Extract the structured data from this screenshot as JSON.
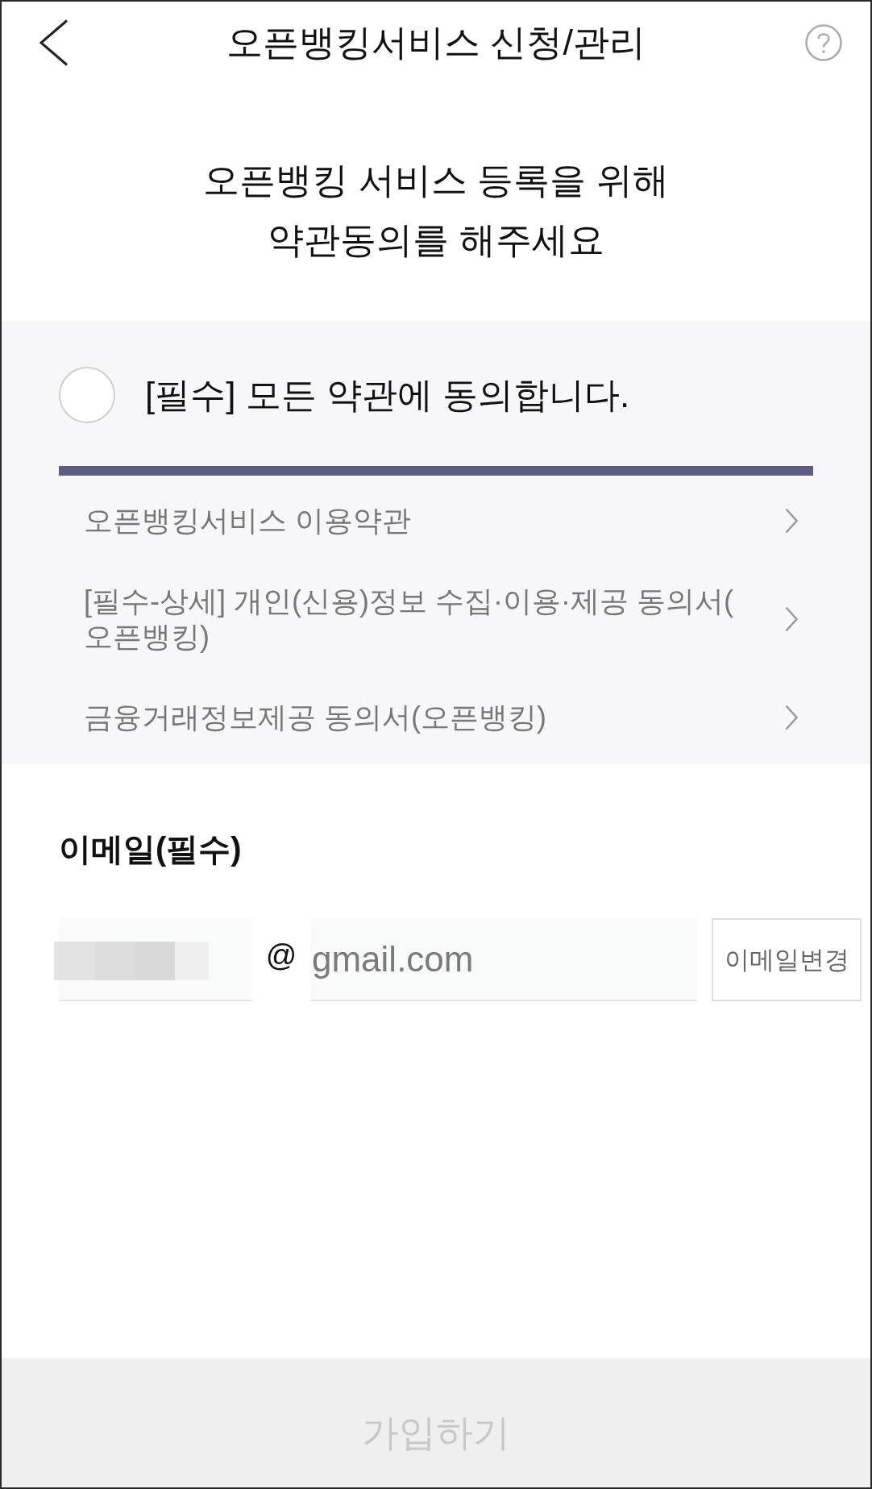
{
  "header": {
    "title": "오픈뱅킹서비스 신청/관리"
  },
  "intro": {
    "lines": [
      "오픈뱅킹 서비스 등록을 위해",
      "약관동의를 해주세요"
    ]
  },
  "agree_all": {
    "label": "[필수] 모든 약관에 동의합니다.",
    "checked": false
  },
  "terms": [
    {
      "label": "오픈뱅킹서비스 이용약관"
    },
    {
      "label": "[필수-상세] 개인(신용)정보 수집·이용·제공 동의서(오픈뱅킹)"
    },
    {
      "label": "금융거래정보제공 동의서(오픈뱅킹)"
    }
  ],
  "email": {
    "label": "이메일(필수)",
    "at_sign": "@",
    "domain": "gmail.com",
    "change_button": "이메일변경"
  },
  "submit": {
    "label": "가입하기",
    "disabled": true
  }
}
